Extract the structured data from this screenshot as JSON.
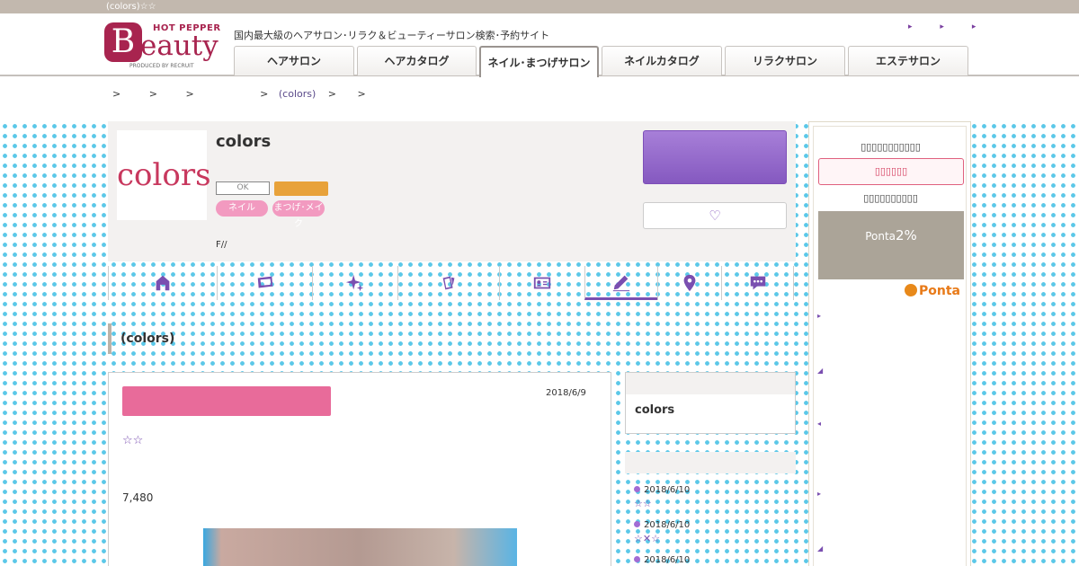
{
  "topbar": {
    "title": "(colors)☆☆"
  },
  "logo": {
    "hotpepper": "HOT PEPPER",
    "initial": "B",
    "word": "eauty",
    "produced": "PRODUCED BY RECRUIT"
  },
  "header": {
    "tagline": "国内最大級のヘアサロン･リラク＆ビューティーサロン検索･予約サイト",
    "arrows": [
      "▸",
      "▸",
      "▸"
    ]
  },
  "tabs": [
    {
      "label": "ヘアサロン",
      "w": 134
    },
    {
      "label": "ヘアカタログ",
      "w": 133
    },
    {
      "label": "ネイル･まつげサロン",
      "w": 133,
      "active": true
    },
    {
      "label": "ネイルカタログ",
      "w": 134
    },
    {
      "label": "リラクサロン",
      "w": 134
    },
    {
      "label": "エステサロン",
      "w": 134
    }
  ],
  "breadcrumb": {
    "sep": ">",
    "link": "(colors)"
  },
  "salon": {
    "logo_text": "colors",
    "name": "colors",
    "badge_ok": "OK",
    "pills": [
      "ネイル",
      "まつげ･メイク"
    ],
    "address": "F//",
    "fav_icon": "♡"
  },
  "section": {
    "title": "(colors)"
  },
  "blog": {
    "date": "2018/6/9",
    "stars": "☆☆",
    "price": "7,480"
  },
  "sidebar": {
    "box_name": "colors",
    "recent": [
      {
        "date": "2018/6/10",
        "title": "☆☆"
      },
      {
        "date": "2018/6/10",
        "title": "☆✕☆"
      },
      {
        "date": "2018/6/10",
        "title": ""
      }
    ]
  },
  "right": {
    "text1": "▯▯▯▯▯▯▯▯▯▯▯",
    "button": "▯▯▯▯▯▯",
    "text2": "▯▯▯▯▯▯▯▯▯▯",
    "ponta_prefix": "Ponta",
    "ponta_pct": "2%",
    "ponta_logo": "Ponta",
    "marks": [
      "▸",
      "◢",
      "◂",
      "▸",
      "◢"
    ]
  },
  "colors": {
    "accent": "#7a4fb0",
    "brand": "#a8244f",
    "reserve": "#8559c0",
    "pink": "#e86b9a",
    "dots": "#5bc8e8"
  }
}
